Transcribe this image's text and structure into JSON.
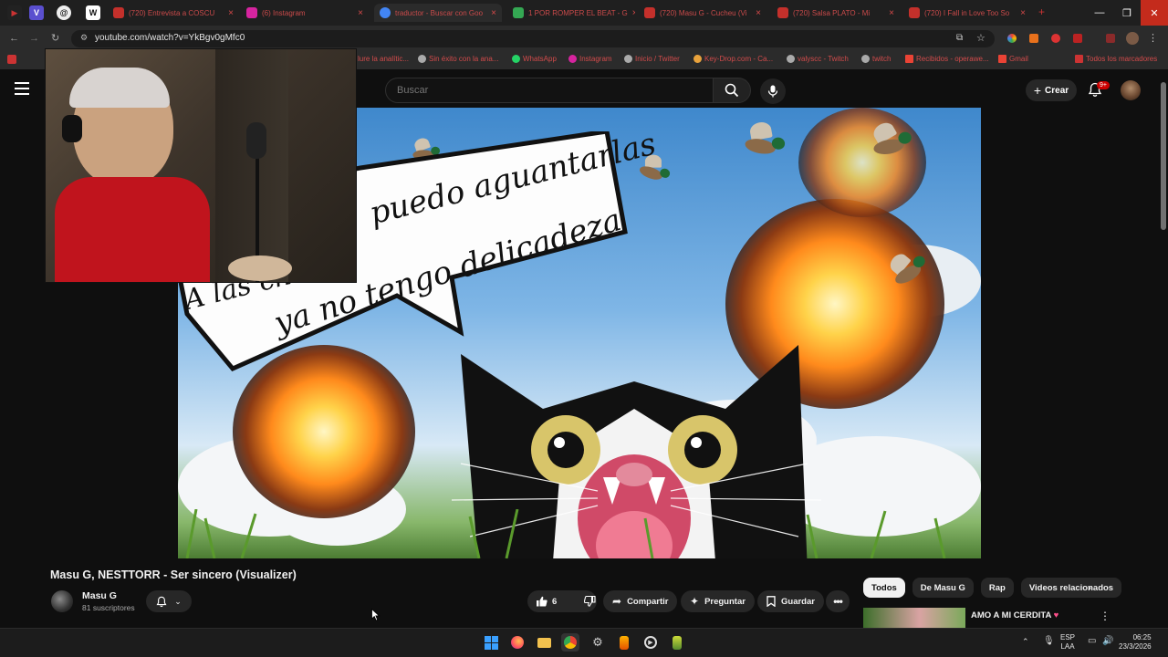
{
  "browser": {
    "tabs": [
      {
        "label": "(720) Entrevista a COSCU",
        "color": "#c4302b"
      },
      {
        "label": "(6) Instagram",
        "color": "#d6249f"
      },
      {
        "label": "traductor - Buscar con Goo",
        "color": "#4285f4"
      },
      {
        "label": "1 POR ROMPER EL BEAT - G",
        "color": "#34a853"
      },
      {
        "label": "(720) Masu G - Cucheu (Vi",
        "color": "#c4302b"
      },
      {
        "label": "(720) Salsa PLATO - Mi",
        "color": "#c4302b"
      },
      {
        "label": "(720) I Fall in Love Too So",
        "color": "#c4302b"
      }
    ],
    "new_tab": "+",
    "url": "youtube.com/watch?v=YkBgv0gMfc0",
    "bookmarks": [
      "lure la analític...",
      "Sin éxito con la ana...",
      "WhatsApp",
      "Instagram",
      "Inicio / Twitter",
      "Key-Drop.com - Ca...",
      "valyscc - Twitch",
      "twitch",
      "Recibidos - operawe...",
      "Gmail",
      "Todos los marcadores"
    ]
  },
  "youtube": {
    "search_placeholder": "Buscar",
    "create_label": "Crear",
    "notif_badge": "9+",
    "video": {
      "title": "Masu G, NESTTORR - Ser sincero (Visualizer)",
      "channel": "Masu G",
      "subscribers": "81 suscriptores",
      "likes": "6",
      "share_label": "Compartir",
      "ask_label": "Preguntar",
      "save_label": "Guardar",
      "overlay_text": [
        "A las ch",
        "puedo aguantarlas",
        "ya no tengo delicadeza"
      ]
    },
    "chips": [
      "Todos",
      "De Masu G",
      "Rap",
      "Videos relacionados"
    ],
    "recommended": {
      "title": "AMO A MI CERDITA",
      "heart": "♥"
    }
  },
  "taskbar": {
    "lang_top": "ESP",
    "lang_bottom": "LAA",
    "time": "06:25",
    "date": "23/3/2026"
  },
  "colors": {
    "yt_bg": "#0f0f0f",
    "pill_bg": "#272727",
    "accent_red": "#cc0000"
  }
}
